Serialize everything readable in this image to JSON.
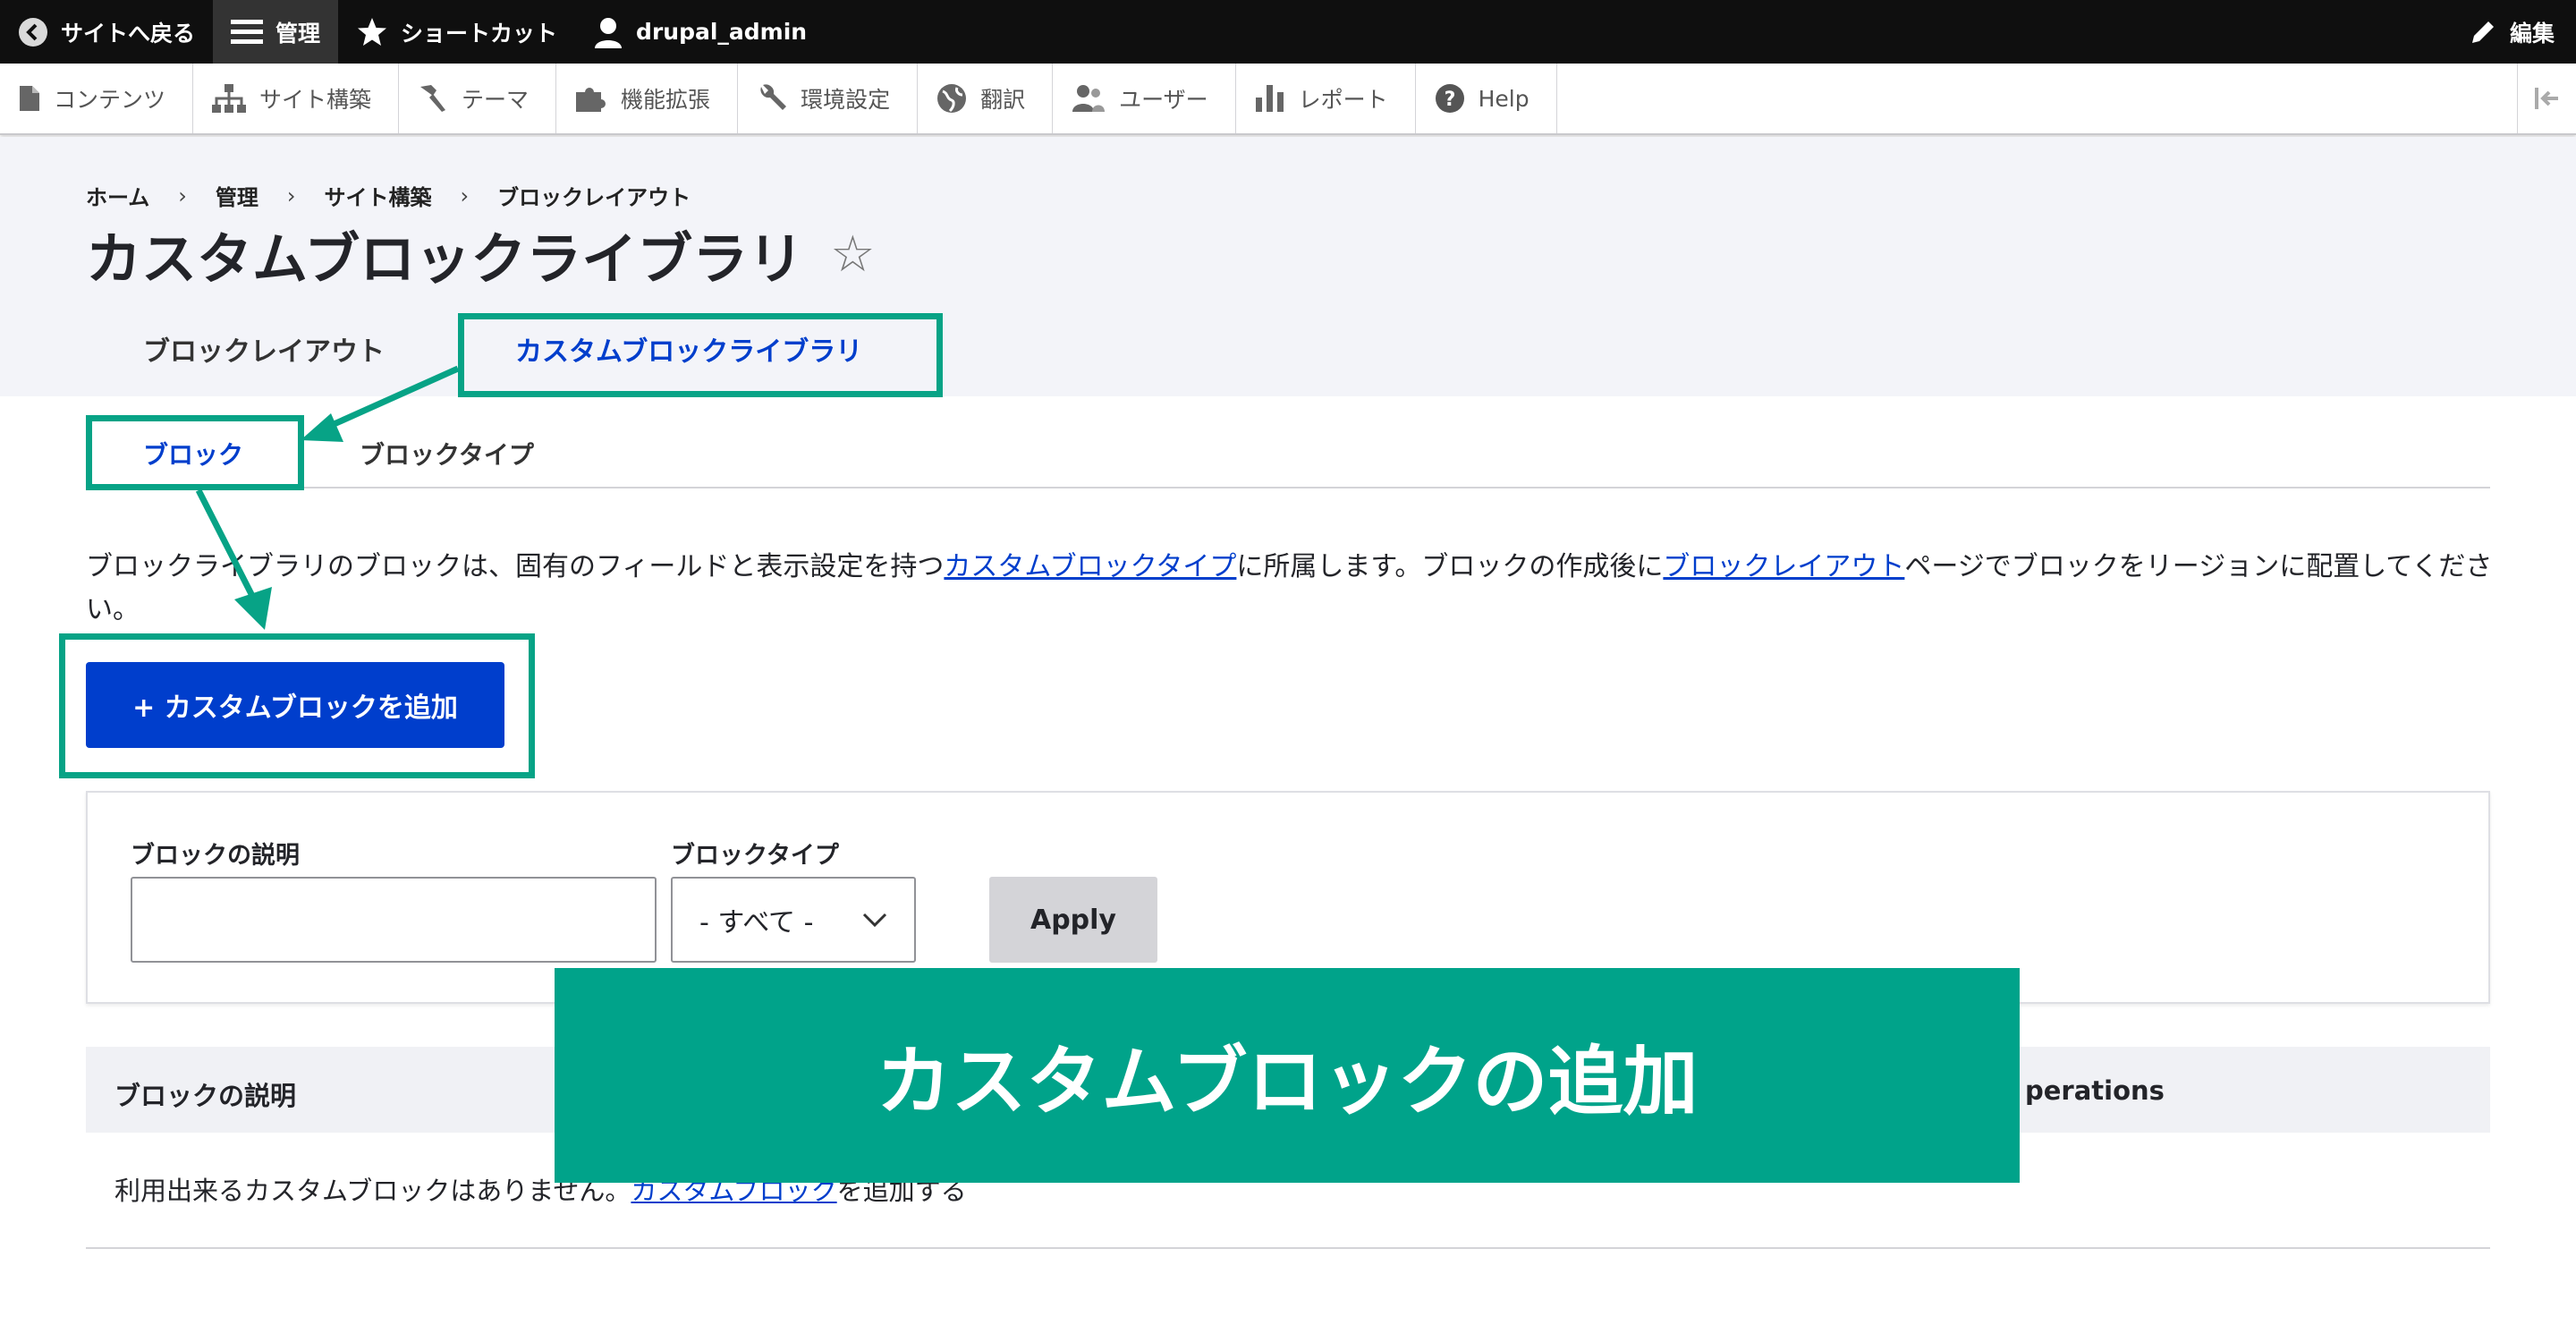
{
  "toolbar": {
    "back_label": "サイトへ戻る",
    "manage_label": "管理",
    "shortcuts_label": "ショートカット",
    "user_label": "drupal_admin",
    "edit_label": "編集"
  },
  "tray": {
    "items": [
      {
        "label": "コンテンツ",
        "icon": "file-icon"
      },
      {
        "label": "サイト構築",
        "icon": "sitemap-icon"
      },
      {
        "label": "テーマ",
        "icon": "brush-icon"
      },
      {
        "label": "機能拡張",
        "icon": "puzzle-icon"
      },
      {
        "label": "環境設定",
        "icon": "wrench-icon"
      },
      {
        "label": "翻訳",
        "icon": "globe-icon"
      },
      {
        "label": "ユーザー",
        "icon": "people-icon"
      },
      {
        "label": "レポート",
        "icon": "bar-chart-icon"
      },
      {
        "label": "Help",
        "icon": "help-icon"
      }
    ]
  },
  "breadcrumb": [
    "ホーム",
    "管理",
    "サイト構築",
    "ブロックレイアウト"
  ],
  "breadcrumb_sep": "›",
  "page": {
    "title": "カスタムブロックライブラリ",
    "star": "☆"
  },
  "primary_tabs": {
    "layout": "ブロックレイアウト",
    "library": "カスタムブロックライブラリ"
  },
  "secondary_tabs": {
    "blocks": "ブロック",
    "block_types": "ブロックタイプ"
  },
  "description": {
    "part1": "ブロックライブラリのブロックは、固有のフィールドと表示設定を持つ",
    "link1": "カスタムブロックタイプ",
    "part2": "に所属します。ブロックの作成後に",
    "link2": "ブロックレイアウト",
    "part3": "ページでブロックをリージョンに配置してください。"
  },
  "add_button": "+ カスタムブロックを追加",
  "filter": {
    "desc_label": "ブロックの説明",
    "desc_value": "",
    "type_label": "ブロックタイプ",
    "type_selected": "- すべて -",
    "apply_label": "Apply"
  },
  "table": {
    "headers": [
      "ブロックの説明",
      "Operations"
    ],
    "headers_visible": [
      "ブロックの説明",
      "perations"
    ],
    "empty_part1": "利用出来るカスタムブロックはありません。",
    "empty_link": "カスタムブロック",
    "empty_part2": "を追加する"
  },
  "overlay": {
    "banner_text": "カスタムブロックの追加",
    "accent_color": "#00a38a"
  },
  "colors": {
    "toolbar_bg": "#0f0f0f",
    "link": "#003ecc",
    "primary_button": "#003ecc",
    "header_bg": "#f3f4f9"
  }
}
